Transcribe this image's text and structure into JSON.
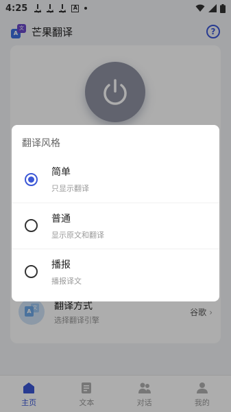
{
  "status_bar": {
    "time": "4:25",
    "notif_letter": "A"
  },
  "header": {
    "app_title": "芒果翻译",
    "logo_a": "A",
    "logo_b": "文"
  },
  "main": {
    "method_title": "翻译方式",
    "method_subtitle": "选择翻译引擎",
    "method_value": "谷歌",
    "method_chevron": "›",
    "method_icon_a": "A",
    "method_icon_b": "文"
  },
  "bottom_nav": {
    "items": [
      {
        "label": "主页",
        "icon": "home-icon",
        "active": true
      },
      {
        "label": "文本",
        "icon": "document-icon",
        "active": false
      },
      {
        "label": "对话",
        "icon": "people-icon",
        "active": false
      },
      {
        "label": "我的",
        "icon": "user-icon",
        "active": false
      }
    ]
  },
  "dialog": {
    "title": "翻译风格",
    "selected": 0,
    "options": [
      {
        "label": "简单",
        "desc": "只显示翻译"
      },
      {
        "label": "普通",
        "desc": "显示原文和翻译"
      },
      {
        "label": "播报",
        "desc": "播报译文"
      }
    ]
  },
  "colors": {
    "accent": "#3b57d6",
    "background": "#f2f3f7",
    "power_button": "#8f93a3"
  }
}
